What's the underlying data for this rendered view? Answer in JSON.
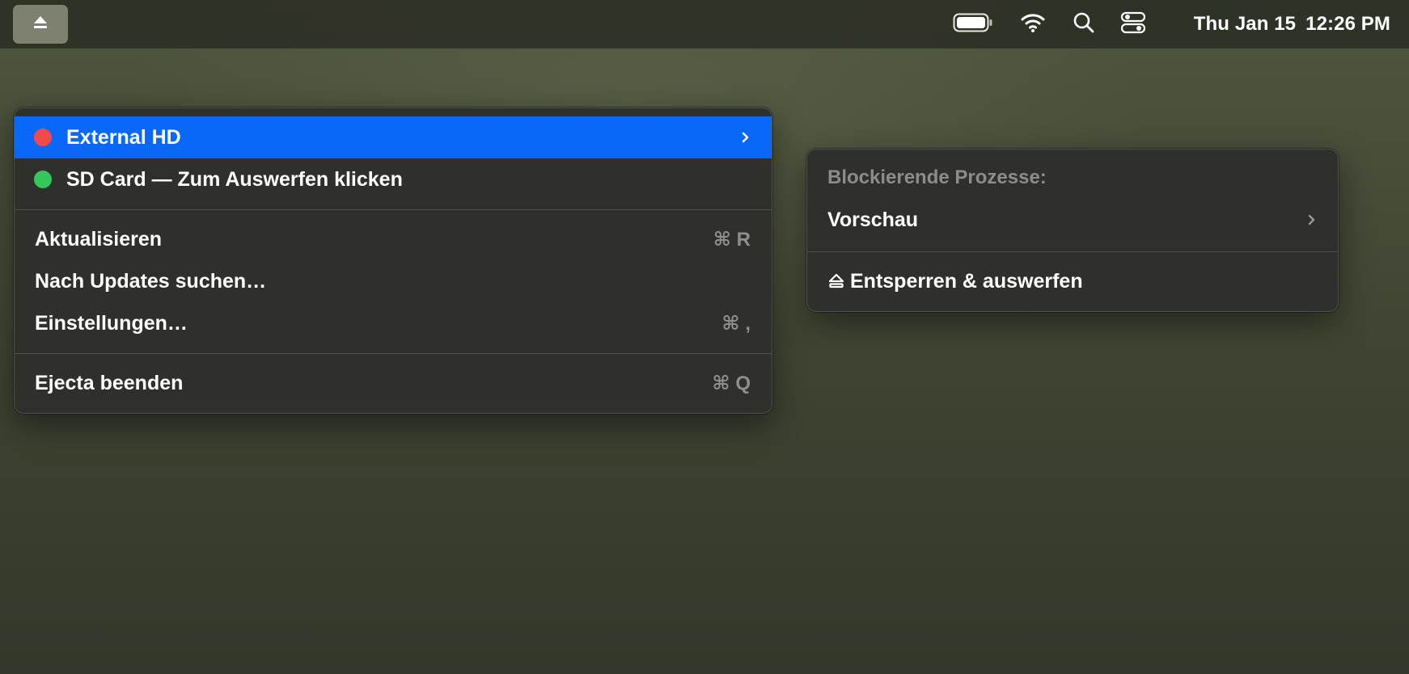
{
  "menubar": {
    "app_icon": "eject-icon",
    "status_icons": [
      "battery-icon",
      "wifi-icon",
      "search-icon",
      "control-center-icon"
    ],
    "date": "Thu Jan 15",
    "time": "12:26 PM"
  },
  "main_menu": {
    "drives": [
      {
        "label": "External HD",
        "status_color": "#f14a4a",
        "has_submenu": true,
        "highlighted": true
      },
      {
        "label": "SD Card — Zum Auswerfen klicken",
        "status_color": "#34c759",
        "has_submenu": false,
        "highlighted": false
      }
    ],
    "actions": [
      {
        "label": "Aktualisieren",
        "shortcut": "⌘ R"
      },
      {
        "label": "Nach Updates suchen…",
        "shortcut": ""
      },
      {
        "label": "Einstellungen…",
        "shortcut": "⌘ ,"
      }
    ],
    "quit": {
      "label": "Ejecta beenden",
      "shortcut": "⌘ Q"
    }
  },
  "submenu": {
    "heading": "Blockierende Prozesse:",
    "process": {
      "label": "Vorschau",
      "has_submenu": true
    },
    "action": {
      "label": "Entsperren & auswerfen",
      "icon": "eject-icon"
    }
  },
  "colors": {
    "highlight": "#0a68f8",
    "menu_background": "#2f2f2c",
    "shortcut_text": "#8e8e8b"
  }
}
